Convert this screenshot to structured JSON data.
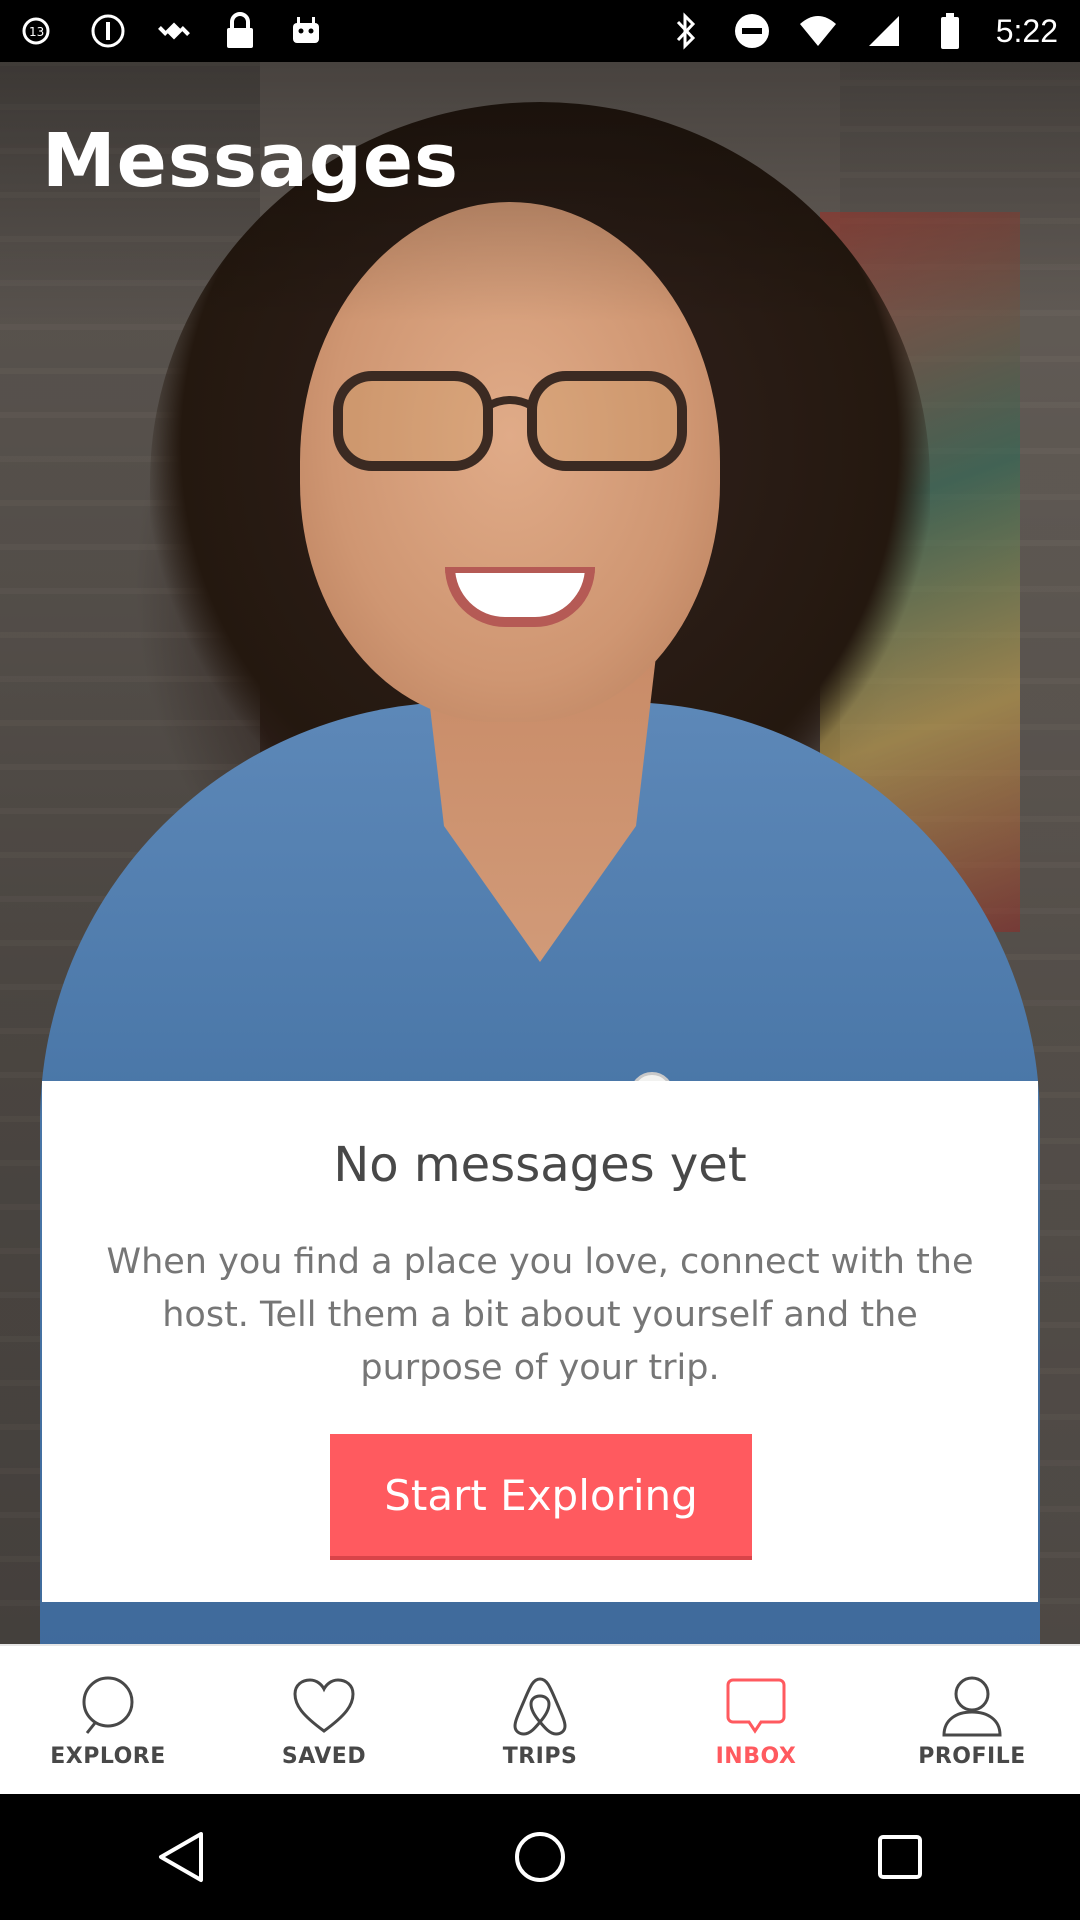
{
  "status_bar": {
    "time": "5:22",
    "left_icons": [
      "abc13-icon",
      "alert-circle-icon",
      "fake-gps-satellite-icon",
      "lock-icon",
      "android-robot-icon"
    ],
    "right_icons": [
      "bluetooth-icon",
      "do-not-disturb-icon",
      "wifi-icon",
      "cellular-signal-icon",
      "battery-icon"
    ]
  },
  "header": {
    "title": "Messages"
  },
  "empty_state": {
    "title": "No messages yet",
    "body": "When you find a place you love, connect with the host. Tell them a bit about yourself and the purpose of your trip.",
    "cta_label": "Start Exploring"
  },
  "tabs": [
    {
      "id": "explore",
      "label": "EXPLORE",
      "icon": "search-icon",
      "active": false
    },
    {
      "id": "saved",
      "label": "SAVED",
      "icon": "heart-icon",
      "active": false
    },
    {
      "id": "trips",
      "label": "TRIPS",
      "icon": "airbnb-belo-icon",
      "active": false
    },
    {
      "id": "inbox",
      "label": "INBOX",
      "icon": "chat-bubble-icon",
      "active": true
    },
    {
      "id": "profile",
      "label": "PROFILE",
      "icon": "person-icon",
      "active": false
    }
  ],
  "colors": {
    "accent": "#ff5a5f",
    "text_dark": "#484848",
    "text_muted": "#767676"
  },
  "nav_bar": {
    "buttons": [
      "back-icon",
      "home-icon",
      "recents-icon"
    ]
  }
}
